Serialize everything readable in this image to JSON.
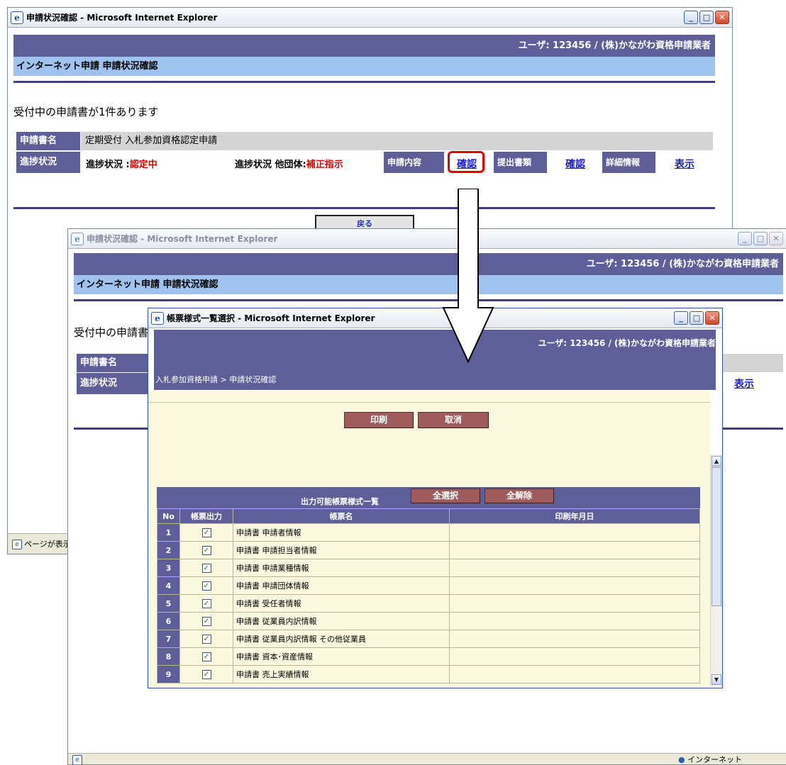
{
  "window1": {
    "title": "申請状況確認 - Microsoft Internet Explorer",
    "user_line": "ユーザ: 123456 / (株)かながわ資格申請業者",
    "page_header": "インターネット申請  申請状況確認",
    "message": "受付中の申請書が1件あります",
    "row1_label": "申請書名",
    "row1_value": "定期受付 入札参加資格認定申請",
    "row2_label": "進捗状況",
    "status_prefix": "進捗状況 :",
    "status_value": "認定中",
    "other_prefix": "進捗状況 他団体:",
    "other_value": "補正指示",
    "content_label": "申請内容",
    "content_link": "確認",
    "docs_label": "提出書類",
    "docs_link": "確認",
    "detail_label": "詳細情報",
    "detail_link": "表示",
    "back_button": "戻る",
    "status_bar": "ページが表示"
  },
  "window2": {
    "title": "申請状況確認 - Microsoft Internet Explorer",
    "user_line": "ユーザ: 123456 / (株)かながわ資格申請業者",
    "page_header": "インターネット申請  申請状況確認",
    "message": "受付中の申請書",
    "row1_label": "申請書名",
    "row2_label": "進捗状況",
    "detail_link": "表示",
    "zone": "インターネット"
  },
  "window3": {
    "title": "帳票様式一覧選択 - Microsoft Internet Explorer",
    "user_line": "ユーザ: 123456 / (株)かながわ資格申請業者",
    "breadcrumb": "入札参加資格申請 > 申請状況確認",
    "print_button": "印刷",
    "cancel_button": "取消",
    "list_title": "出力可能帳票様式一覧",
    "select_all_button": "全選択",
    "clear_all_button": "全解除",
    "columns": [
      "No",
      "帳票出力",
      "帳票名",
      "印刷年月日"
    ],
    "rows": [
      {
        "no": "1",
        "checked": true,
        "name": "申請書  申請者情報",
        "date": ""
      },
      {
        "no": "2",
        "checked": true,
        "name": "申請書  申請担当者情報",
        "date": ""
      },
      {
        "no": "3",
        "checked": true,
        "name": "申請書  申請業種情報",
        "date": ""
      },
      {
        "no": "4",
        "checked": true,
        "name": "申請書  申請団体情報",
        "date": ""
      },
      {
        "no": "5",
        "checked": true,
        "name": "申請書  受任者情報",
        "date": ""
      },
      {
        "no": "6",
        "checked": true,
        "name": "申請書  従業員内訳情報",
        "date": ""
      },
      {
        "no": "7",
        "checked": true,
        "name": "申請書  従業員内訳情報 その他従業員",
        "date": ""
      },
      {
        "no": "8",
        "checked": true,
        "name": "申請書  資本･資産情報",
        "date": ""
      },
      {
        "no": "9",
        "checked": true,
        "name": "申請書  売上実績情報",
        "date": ""
      }
    ]
  },
  "colors": {
    "navy": "#5e5f99",
    "highlight": "#e60000",
    "link": "#1a1adb",
    "cream": "#fbf8e0",
    "header_blue": "#9fc3ee"
  }
}
